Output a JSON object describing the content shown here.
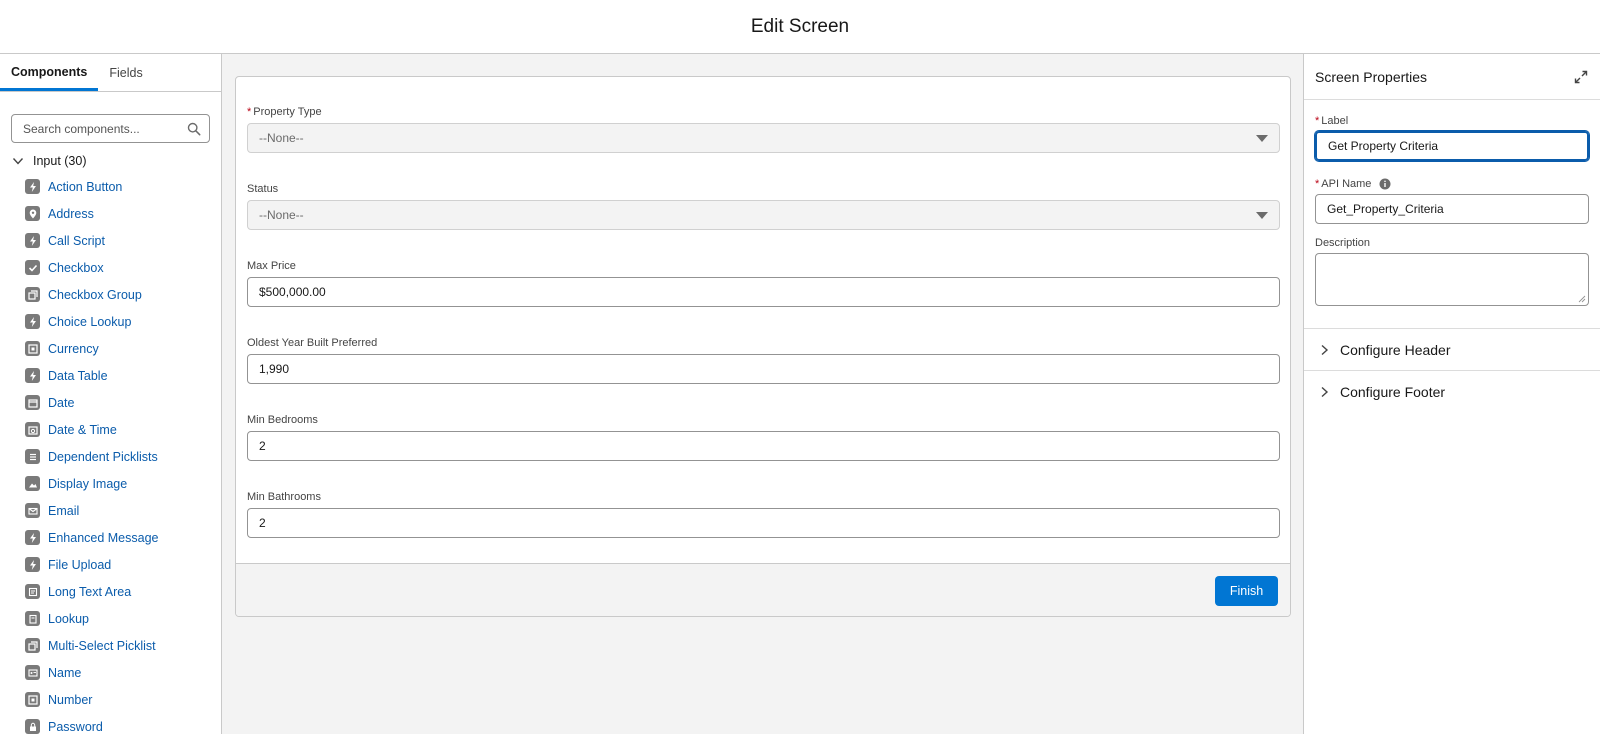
{
  "header": {
    "title": "Edit Screen"
  },
  "left_panel": {
    "tabs": [
      {
        "label": "Components",
        "active": true
      },
      {
        "label": "Fields",
        "active": false
      }
    ],
    "search": {
      "placeholder": "Search components..."
    },
    "section": {
      "label": "Input (30)"
    },
    "components": [
      {
        "label": "Action Button",
        "icon": "bolt-icon"
      },
      {
        "label": "Address",
        "icon": "location-pin-icon"
      },
      {
        "label": "Call Script",
        "icon": "bolt-icon"
      },
      {
        "label": "Checkbox",
        "icon": "checkmark-icon"
      },
      {
        "label": "Checkbox Group",
        "icon": "stacked-squares-icon"
      },
      {
        "label": "Choice Lookup",
        "icon": "bolt-icon"
      },
      {
        "label": "Currency",
        "icon": "currency-icon"
      },
      {
        "label": "Data Table",
        "icon": "bolt-icon"
      },
      {
        "label": "Date",
        "icon": "calendar-icon"
      },
      {
        "label": "Date & Time",
        "icon": "calendar-clock-icon"
      },
      {
        "label": "Dependent Picklists",
        "icon": "list-icon"
      },
      {
        "label": "Display Image",
        "icon": "image-icon"
      },
      {
        "label": "Email",
        "icon": "envelope-icon"
      },
      {
        "label": "Enhanced Message",
        "icon": "bolt-icon"
      },
      {
        "label": "File Upload",
        "icon": "bolt-icon"
      },
      {
        "label": "Long Text Area",
        "icon": "text-area-icon"
      },
      {
        "label": "Lookup",
        "icon": "lookup-icon"
      },
      {
        "label": "Multi-Select Picklist",
        "icon": "stacked-squares-icon"
      },
      {
        "label": "Name",
        "icon": "id-card-icon"
      },
      {
        "label": "Number",
        "icon": "number-icon"
      },
      {
        "label": "Password",
        "icon": "lock-icon"
      }
    ]
  },
  "screen": {
    "fields": [
      {
        "label": "Property Type",
        "required": true,
        "type": "select",
        "value": "--None--"
      },
      {
        "label": "Status",
        "required": false,
        "type": "select",
        "value": "--None--"
      },
      {
        "label": "Max Price",
        "required": false,
        "type": "text",
        "value": "$500,000.00"
      },
      {
        "label": "Oldest Year Built Preferred",
        "required": false,
        "type": "text",
        "value": "1,990"
      },
      {
        "label": "Min Bedrooms",
        "required": false,
        "type": "text",
        "value": "2"
      },
      {
        "label": "Min Bathrooms",
        "required": false,
        "type": "text",
        "value": "2"
      }
    ],
    "finish_label": "Finish"
  },
  "right_panel": {
    "title": "Screen Properties",
    "label_field": {
      "label": "Label",
      "value": "Get Property Criteria"
    },
    "api_name_field": {
      "label": "API Name",
      "value": "Get_Property_Criteria"
    },
    "description_field": {
      "label": "Description",
      "value": ""
    },
    "sections": [
      {
        "label": "Configure Header"
      },
      {
        "label": "Configure Footer"
      }
    ]
  },
  "colors": {
    "brand": "#0176d3",
    "link": "#0b5cab",
    "required": "#ba0517"
  }
}
